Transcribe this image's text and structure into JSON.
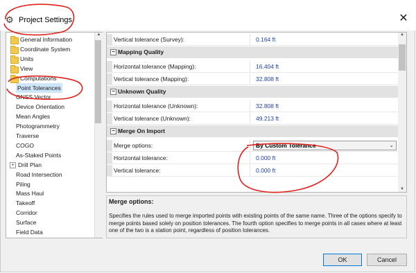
{
  "window": {
    "title": "Project Settings",
    "title_icon": "gear-icon",
    "close_glyph": "✕"
  },
  "tree": {
    "items": [
      {
        "label": "General Information",
        "icon": "folder-icon",
        "folder": true
      },
      {
        "label": "Coordinate System",
        "icon": "folder-icon",
        "folder": true
      },
      {
        "label": "Units",
        "icon": "folder-icon",
        "folder": true
      },
      {
        "label": "View",
        "icon": "folder-icon",
        "folder": true
      },
      {
        "label": "Computations",
        "icon": "folder-icon",
        "folder": true
      },
      {
        "label": "Point Tolerances",
        "selected": true
      },
      {
        "label": "GNSS Vector"
      },
      {
        "label": "Device Orientation"
      },
      {
        "label": "Mean Angles"
      },
      {
        "label": "Photogrammetry"
      },
      {
        "label": "Traverse"
      },
      {
        "label": "COGO"
      },
      {
        "label": "As-Staked Points"
      },
      {
        "label": "Drill Plan",
        "expander": "+"
      },
      {
        "label": "Road Intersection"
      },
      {
        "label": "Piling"
      },
      {
        "label": "Mass Haul"
      },
      {
        "label": "Takeoff"
      },
      {
        "label": "Corridor"
      },
      {
        "label": "Surface"
      },
      {
        "label": "Field Data"
      }
    ]
  },
  "grid": {
    "rows": [
      {
        "type": "prop",
        "name": "Vertical tolerance (Survey):",
        "value": "0.164 ft"
      },
      {
        "type": "cat",
        "name": "Mapping Quality",
        "toggle": "−"
      },
      {
        "type": "prop",
        "name": "Horizontal tolerance (Mapping):",
        "value": "16.404 ft"
      },
      {
        "type": "prop",
        "name": "Vertical tolerance (Mapping):",
        "value": "32.808 ft"
      },
      {
        "type": "cat",
        "name": "Unknown Quality",
        "toggle": "−"
      },
      {
        "type": "prop",
        "name": "Horizontal tolerance (Unknown):",
        "value": "32.808 ft"
      },
      {
        "type": "prop",
        "name": "Vertical tolerance (Unknown):",
        "value": "49.213 ft"
      },
      {
        "type": "cat",
        "name": "Merge On Import",
        "toggle": "−"
      },
      {
        "type": "combo",
        "name": "Merge options:",
        "value": "By Custom Tolerance"
      },
      {
        "type": "prop",
        "name": "Horizontal tolerance:",
        "value": "0.000 ft"
      },
      {
        "type": "prop",
        "name": "Vertical tolerance:",
        "value": "0.000 ft"
      }
    ]
  },
  "description": {
    "title": "Merge options:",
    "text": "Specifies the rules used to merge imported points with existing points of the same name. Three of the options specify to merge points based solely on position tolerances. The fourth option specifies to merge points in all cases where at least one of the two is a station point, regardless of position tolerances."
  },
  "buttons": {
    "ok": "OK",
    "cancel": "Cancel"
  },
  "colors": {
    "annotation": "#e0201b",
    "value_text": "#1f3fae",
    "selection": "#cfe5fb"
  }
}
